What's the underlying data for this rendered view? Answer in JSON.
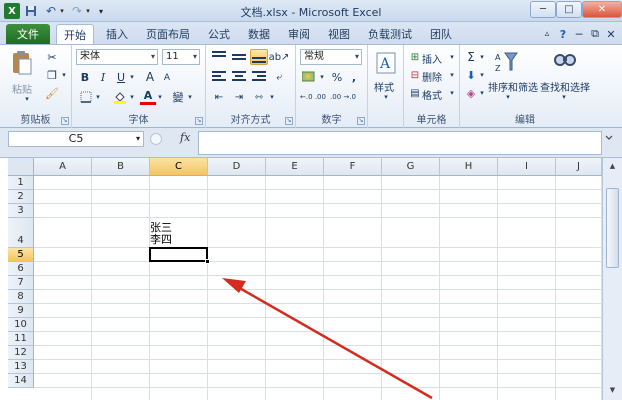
{
  "window": {
    "title": "文档.xlsx - Microsoft Excel",
    "minimize": "─",
    "maximize": "□",
    "close": "✕"
  },
  "quick_access": {
    "app_icon": "excel-icon",
    "save_icon": "save-icon",
    "undo_icon": "undo-icon",
    "redo_icon": "redo-icon",
    "customize_icon": "chevron-down-icon"
  },
  "tabs": [
    "文件",
    "开始",
    "插入",
    "页面布局",
    "公式",
    "数据",
    "审阅",
    "视图",
    "负载测试",
    "团队"
  ],
  "ribbon": {
    "clipboard": {
      "label": "剪贴板",
      "paste": "粘贴"
    },
    "font": {
      "label": "字体",
      "name": "宋体",
      "size": "11",
      "bold": "B",
      "italic": "I",
      "underline": "U",
      "grow": "A",
      "shrink": "A",
      "color": "A",
      "wen": "變"
    },
    "alignment": {
      "label": "对齐方式"
    },
    "number": {
      "label": "数字",
      "format": "常规",
      "percent": "%",
      "comma": ",",
      "inc_decimal": "←.0 .00",
      "dec_decimal": ".00 →.0"
    },
    "styles": {
      "label": "样式"
    },
    "cells": {
      "label": "单元格",
      "insert": "插入",
      "delete": "删除",
      "format": "格式"
    },
    "editing": {
      "label": "编辑",
      "sum": "Σ",
      "sort_filter": "排序和筛选",
      "find_select": "查找和选择"
    }
  },
  "formula_bar": {
    "name_box": "C5",
    "fx": "fx",
    "content": ""
  },
  "sheet": {
    "columns": [
      "A",
      "B",
      "C",
      "D",
      "E",
      "F",
      "G",
      "H",
      "I",
      "J"
    ],
    "rows": [
      "1",
      "2",
      "3",
      "4",
      "5",
      "6",
      "7",
      "8",
      "9",
      "10",
      "11",
      "12",
      "13",
      "14"
    ],
    "selected_cell": "C5",
    "cell_c4_line1": "张三",
    "cell_c4_line2": "李四"
  },
  "colors": {
    "file_tab": "#2a7d2e",
    "selection_highlight": "#f7c35a",
    "annotation_arrow": "#d42a1f"
  }
}
